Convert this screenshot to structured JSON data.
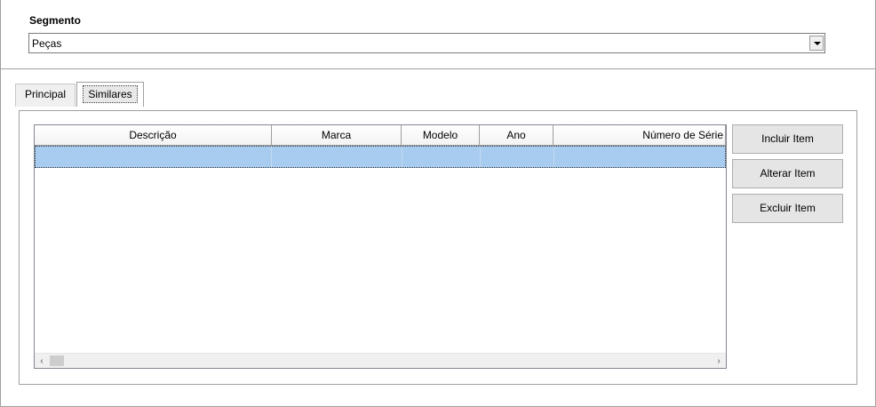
{
  "segmento": {
    "label": "Segmento",
    "selected": "Peças"
  },
  "tabs": [
    {
      "label": "Principal"
    },
    {
      "label": "Similares"
    }
  ],
  "grid": {
    "columns": [
      "Descrição",
      "Marca",
      "Modelo",
      "Ano",
      "Número de Série"
    ]
  },
  "buttons": {
    "incluir": "Incluir Item",
    "alterar": "Alterar Item",
    "excluir": "Excluir Item"
  },
  "icons": {
    "dropdown": "chevron-down-icon",
    "scroll_left": "chevron-left-icon",
    "scroll_right": "chevron-right-icon"
  }
}
